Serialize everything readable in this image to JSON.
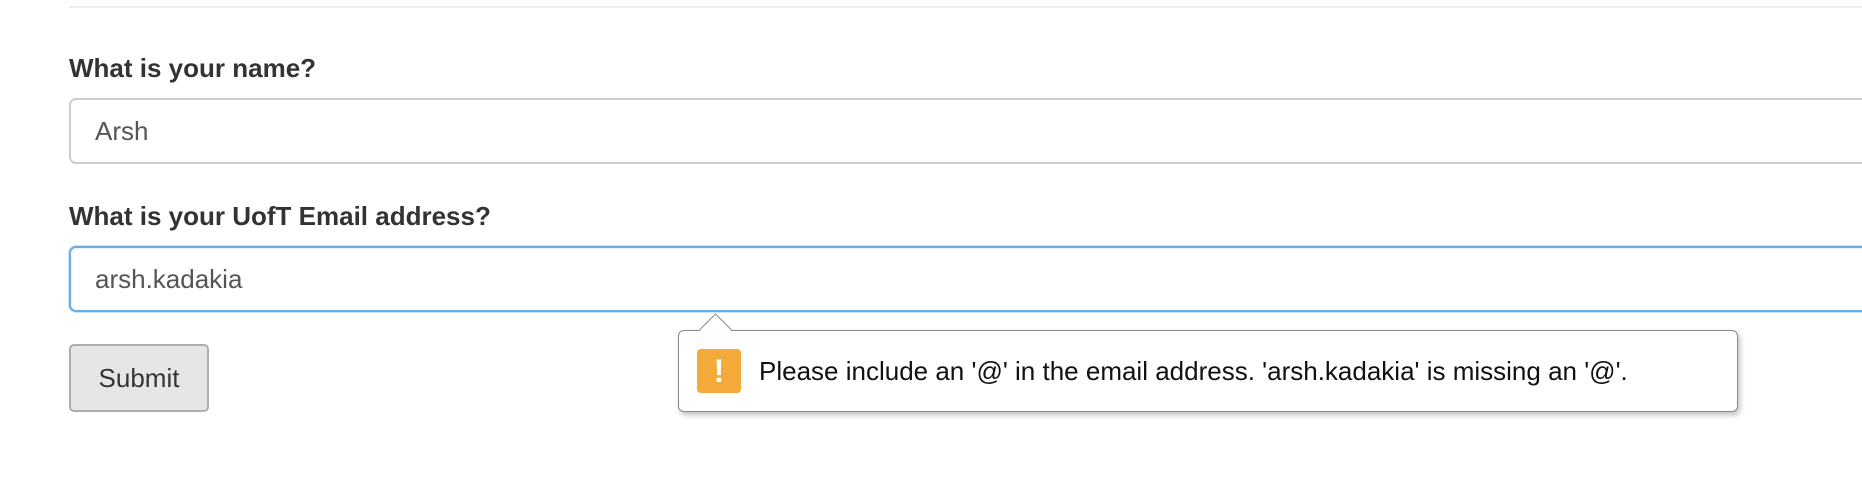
{
  "form": {
    "name_label": "What is your name?",
    "name_value": "Arsh",
    "email_label": "What is your UofT Email address?",
    "email_value": "arsh.kadakia",
    "submit_label": "Submit"
  },
  "validation_tooltip": {
    "icon": "warning-icon",
    "icon_glyph": "!",
    "icon_color": "#f4a93b",
    "message": "Please include an '@' in the email address. 'arsh.kadakia' is missing an '@'."
  },
  "colors": {
    "focus_border": "#66afe9",
    "button_bg": "#e6e6e6"
  }
}
